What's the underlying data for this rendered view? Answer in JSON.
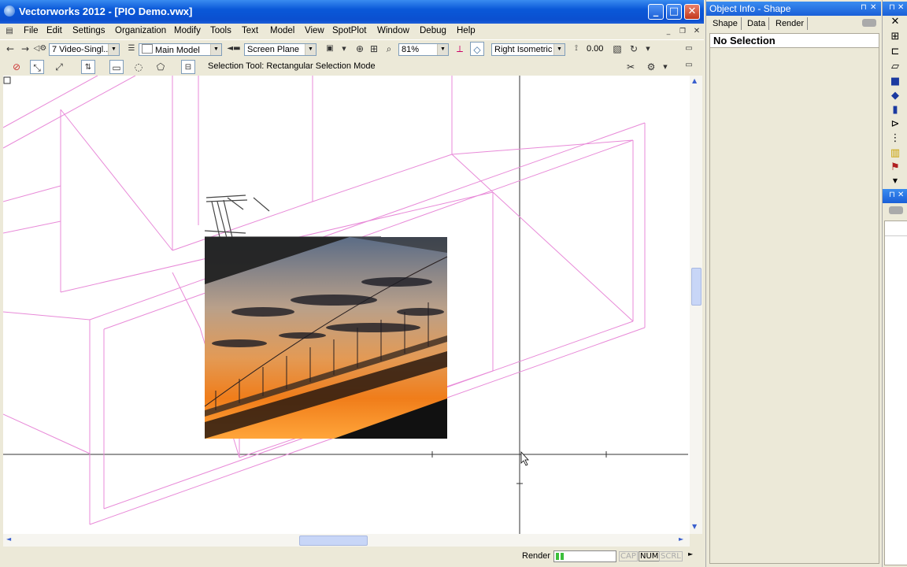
{
  "window": {
    "title": "Vectorworks 2012 - [PIO Demo.vwx]",
    "minimize_glyph": "_",
    "maximize_glyph": "□",
    "close_glyph": "✕"
  },
  "menu": {
    "items": [
      "File",
      "Edit",
      "Settings",
      "Organization",
      "Modify",
      "Tools",
      "Text",
      "Model",
      "View",
      "SpotPlot",
      "Window",
      "Debug",
      "Help"
    ]
  },
  "toolbar": {
    "class_selector": "7 Video-Singl...",
    "layer_selector": "Main Model",
    "plane_selector": "Screen Plane",
    "zoom": "81%",
    "view_selector": "Right Isometric",
    "angle_value": "0.00"
  },
  "mode_bar": {
    "status_text": "Selection Tool: Rectangular Selection Mode"
  },
  "statusbar": {
    "render_label": "Render",
    "indicators": [
      "CAP",
      "NUM",
      "SCRL"
    ]
  },
  "object_info": {
    "title": "Object Info - Shape",
    "tabs": [
      "Shape",
      "Data",
      "Render"
    ],
    "selection_text": "No Selection"
  },
  "icons": {
    "back": "←",
    "forward": "→",
    "settings": "⚙",
    "pin": "⊓",
    "close": "✕"
  },
  "colors": {
    "title_blue": "#0a58d8",
    "wireframe_pink": "#e88ad8",
    "canvas_bg": "#ffffff"
  }
}
